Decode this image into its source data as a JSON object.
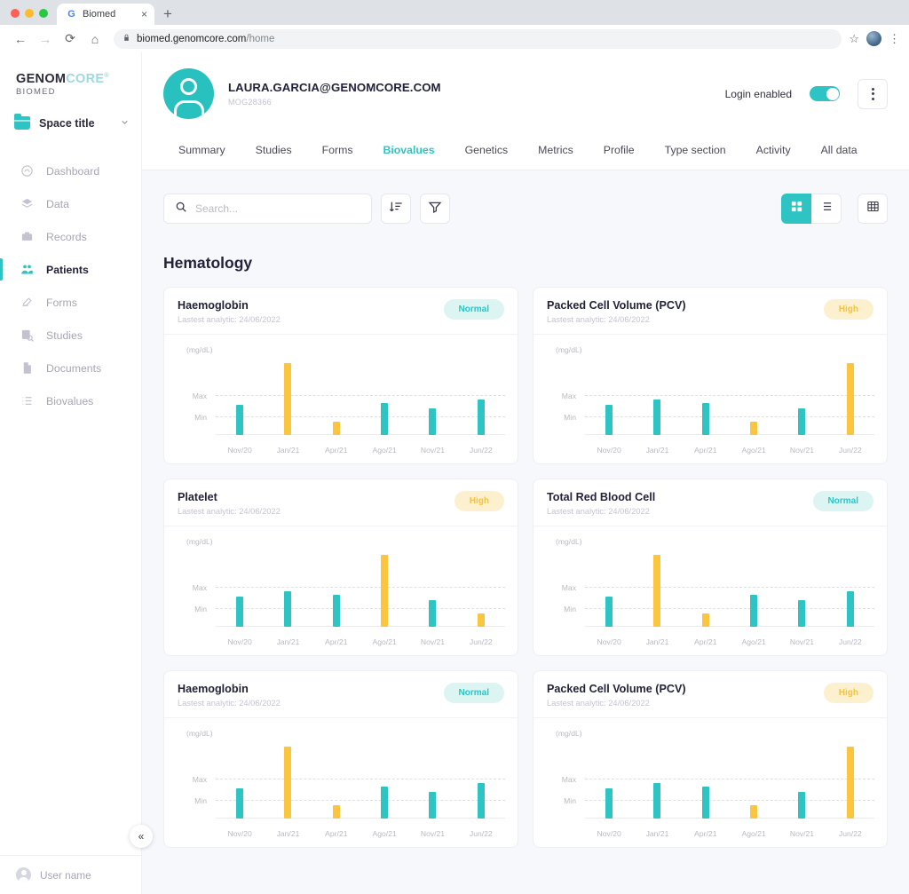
{
  "browser": {
    "tab_title": "Biomed",
    "tab_favicon": "G",
    "tab_close": "×",
    "new_tab": "+",
    "back_icon": "←",
    "forward_icon": "→",
    "reload_icon": "⟳",
    "home_icon": "⌂",
    "lock_icon": "🔒",
    "url_domain": "biomed.genomcore.com",
    "url_path": "/home",
    "star_icon": "☆",
    "kebab_icon": "⋮"
  },
  "sidebar": {
    "logo_first": "GENOM",
    "logo_accent": "CORE",
    "logo_tm": "®",
    "logo_sub": "BIOMED",
    "space_label": "Space title",
    "items": [
      {
        "label": "Dashboard",
        "icon": "dashboard-icon",
        "active": false
      },
      {
        "label": "Data",
        "icon": "data-icon",
        "active": false
      },
      {
        "label": "Records",
        "icon": "records-icon",
        "active": false
      },
      {
        "label": "Patients",
        "icon": "patients-icon",
        "active": true
      },
      {
        "label": "Forms",
        "icon": "forms-icon",
        "active": false
      },
      {
        "label": "Studies",
        "icon": "studies-icon",
        "active": false
      },
      {
        "label": "Documents",
        "icon": "documents-icon",
        "active": false
      },
      {
        "label": "Biovalues",
        "icon": "biovalues-icon",
        "active": false
      }
    ],
    "collapse_icon": "«",
    "user_name": "User name"
  },
  "header": {
    "patient_email": "LAURA.GARCIA@GENOMCORE.COM",
    "patient_id": "MOG28366",
    "login_label": "Login enabled",
    "login_enabled": true
  },
  "tabs": [
    {
      "label": "Summary",
      "active": false
    },
    {
      "label": "Studies",
      "active": false
    },
    {
      "label": "Forms",
      "active": false
    },
    {
      "label": "Biovalues",
      "active": true
    },
    {
      "label": "Genetics",
      "active": false
    },
    {
      "label": "Metrics",
      "active": false
    },
    {
      "label": "Profile",
      "active": false
    },
    {
      "label": "Type section",
      "active": false
    },
    {
      "label": "Activity",
      "active": false
    },
    {
      "label": "All data",
      "active": false
    }
  ],
  "toolbar": {
    "search_placeholder": "Search...",
    "search_value": "",
    "sort_icon": "sort-descending-icon",
    "filter_icon": "filter-icon",
    "views": [
      {
        "name": "grid-view",
        "active": true
      },
      {
        "name": "list-view",
        "active": false
      },
      {
        "name": "table-view",
        "active": false
      }
    ]
  },
  "section": {
    "title": "Hematology"
  },
  "colors": {
    "teal": "#2ec4c4",
    "amber": "#fbc53f",
    "badge_normal_bg": "#ddf5f2",
    "badge_high_bg": "#fdf0cf",
    "text_dark": "#22223a",
    "muted": "#b9b9c6"
  },
  "chart_data": [
    {
      "type": "bar",
      "title": "Haemoglobin",
      "subtitle": "Lastest analytic: 24/06/2022",
      "status": "Normal",
      "ylabel": "(mg/dL)",
      "categories": [
        "Nov/20",
        "Jan/21",
        "Apr/21",
        "Ago/21",
        "Nov/21",
        "Jun/22"
      ],
      "values": [
        42,
        100,
        18,
        45,
        37,
        50
      ],
      "colors": [
        "teal",
        "amber",
        "amber",
        "teal",
        "teal",
        "teal"
      ],
      "gridlines": [
        {
          "label": "Max",
          "value": 72
        },
        {
          "label": "Min",
          "value": 33
        }
      ],
      "ylim": [
        0,
        115
      ]
    },
    {
      "type": "bar",
      "title": "Packed Cell Volume (PCV)",
      "subtitle": "Lastest analytic: 24/06/2022",
      "status": "High",
      "ylabel": "(mg/dL)",
      "categories": [
        "Nov/20",
        "Jan/21",
        "Apr/21",
        "Ago/21",
        "Nov/21",
        "Jun/22"
      ],
      "values": [
        42,
        50,
        45,
        18,
        37,
        100
      ],
      "colors": [
        "teal",
        "teal",
        "teal",
        "amber",
        "teal",
        "amber"
      ],
      "gridlines": [
        {
          "label": "Max",
          "value": 72
        },
        {
          "label": "Min",
          "value": 33
        }
      ],
      "ylim": [
        0,
        115
      ]
    },
    {
      "type": "bar",
      "title": "Platelet",
      "subtitle": "Lastest analytic: 24/06/2022",
      "status": "High",
      "ylabel": "(mg/dL)",
      "categories": [
        "Nov/20",
        "Jan/21",
        "Apr/21",
        "Ago/21",
        "Nov/21",
        "Jun/22"
      ],
      "values": [
        42,
        50,
        45,
        100,
        37,
        18
      ],
      "colors": [
        "teal",
        "teal",
        "teal",
        "amber",
        "teal",
        "amber"
      ],
      "gridlines": [
        {
          "label": "Max",
          "value": 72
        },
        {
          "label": "Min",
          "value": 33
        }
      ],
      "ylim": [
        0,
        115
      ]
    },
    {
      "type": "bar",
      "title": "Total Red Blood Cell",
      "subtitle": "Lastest analytic: 24/06/2022",
      "status": "Normal",
      "ylabel": "(mg/dL)",
      "categories": [
        "Nov/20",
        "Jan/21",
        "Apr/21",
        "Ago/21",
        "Nov/21",
        "Jun/22"
      ],
      "values": [
        42,
        100,
        18,
        45,
        37,
        50
      ],
      "colors": [
        "teal",
        "amber",
        "amber",
        "teal",
        "teal",
        "teal"
      ],
      "gridlines": [
        {
          "label": "Max",
          "value": 72
        },
        {
          "label": "Min",
          "value": 33
        }
      ],
      "ylim": [
        0,
        115
      ]
    },
    {
      "type": "bar",
      "title": "Haemoglobin",
      "subtitle": "Lastest analytic: 24/06/2022",
      "status": "Normal",
      "ylabel": "(mg/dL)",
      "categories": [
        "Nov/20",
        "Jan/21",
        "Apr/21",
        "Ago/21",
        "Nov/21",
        "Jun/22"
      ],
      "values": [
        42,
        100,
        18,
        45,
        37,
        50
      ],
      "colors": [
        "teal",
        "amber",
        "amber",
        "teal",
        "teal",
        "teal"
      ],
      "gridlines": [
        {
          "label": "Max",
          "value": 72
        },
        {
          "label": "Min",
          "value": 33
        }
      ],
      "ylim": [
        0,
        115
      ]
    },
    {
      "type": "bar",
      "title": "Packed Cell Volume (PCV)",
      "subtitle": "Lastest analytic: 24/06/2022",
      "status": "High",
      "ylabel": "(mg/dL)",
      "categories": [
        "Nov/20",
        "Jan/21",
        "Apr/21",
        "Ago/21",
        "Nov/21",
        "Jun/22"
      ],
      "values": [
        42,
        50,
        45,
        18,
        37,
        100
      ],
      "colors": [
        "teal",
        "teal",
        "teal",
        "amber",
        "teal",
        "amber"
      ],
      "gridlines": [
        {
          "label": "Max",
          "value": 72
        },
        {
          "label": "Min",
          "value": 33
        }
      ],
      "ylim": [
        0,
        115
      ]
    }
  ]
}
